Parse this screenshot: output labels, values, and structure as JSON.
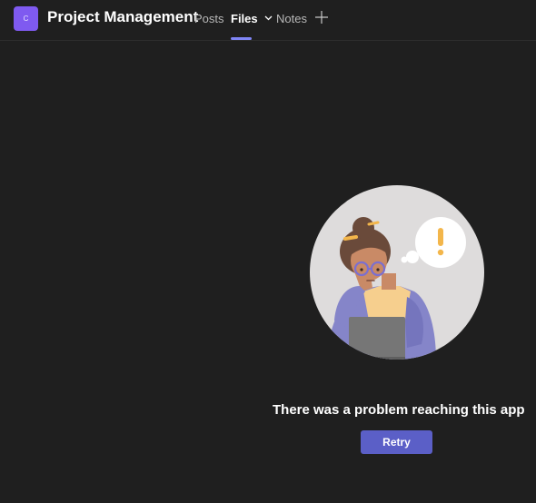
{
  "header": {
    "team_initial": "C",
    "team_name": "Project Management",
    "tabs": [
      {
        "label": "Posts"
      },
      {
        "label": "Files"
      },
      {
        "label": "Notes"
      }
    ],
    "active_tab": "Files",
    "add_tab_icon": "plus-icon",
    "files_tab_icon": "chevron-down-icon"
  },
  "main": {
    "illustration_icon": "woman-at-laptop-thinking-exclamation-illustration",
    "error_message": "There was a problem reaching this app",
    "retry_label": "Retry"
  },
  "colors": {
    "background": "#1f1f1f",
    "accent": "#5b5fc7",
    "avatar": "#7f5af0",
    "active_tab_indicator": "#7f85f5"
  }
}
